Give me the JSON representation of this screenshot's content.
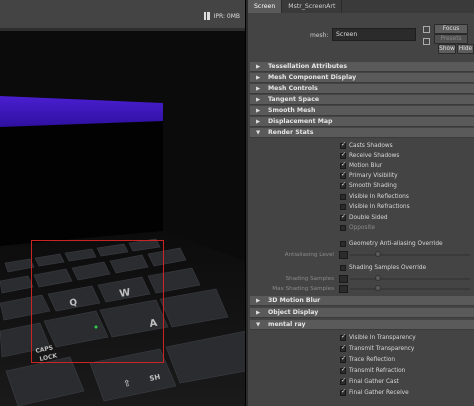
{
  "viewport": {
    "ipr_status": "IPR: 0MB"
  },
  "attribute_editor": {
    "tabs": [
      {
        "label": "Screen",
        "active": true
      },
      {
        "label": "Mstr_ScreenArt",
        "active": false
      }
    ],
    "mesh_label": "mesh:",
    "mesh_value": "Screen",
    "buttons": {
      "focus": "Focus",
      "presets": "Presets",
      "show": "Show",
      "hide": "Hide"
    },
    "sections": {
      "tessellation": "Tessellation Attributes",
      "mesh_component_display": "Mesh Component Display",
      "mesh_controls": "Mesh Controls",
      "tangent_space": "Tangent Space",
      "smooth_mesh": "Smooth Mesh",
      "displacement_map": "Displacement Map",
      "render_stats": "Render Stats",
      "motion_blur_3d": "3D Motion Blur",
      "object_display": "Object Display",
      "mental_ray": "mental ray"
    },
    "render_stats": [
      {
        "label": "Casts Shadows",
        "checked": true
      },
      {
        "label": "Receive Shadows",
        "checked": true
      },
      {
        "label": "Motion Blur",
        "checked": true
      },
      {
        "label": "Primary Visibility",
        "checked": true
      },
      {
        "label": "Smooth Shading",
        "checked": true
      },
      {
        "label": "Visible In Reflections",
        "checked": false
      },
      {
        "label": "Visible In Refractions",
        "checked": false
      },
      {
        "label": "Double Sided",
        "checked": true
      },
      {
        "label": "Opposite",
        "checked": false
      }
    ],
    "geometry_aa_override": "Geometry Anti-aliasing Override",
    "antialiasing_level_label": "Antialiasing Level",
    "shading_samples_override": "Shading Samples Override",
    "shading_samples_label": "Shading Samples",
    "max_shading_samples_label": "Max Shading Samples",
    "mental_ray_items": [
      {
        "label": "Visible In Transparency",
        "checked": true
      },
      {
        "label": "Transmit Transparency",
        "checked": true
      },
      {
        "label": "Trace Reflection",
        "checked": true
      },
      {
        "label": "Transmit Refraction",
        "checked": true
      },
      {
        "label": "Final Gather Cast",
        "checked": true
      },
      {
        "label": "Final Gather Receive",
        "checked": true
      }
    ]
  }
}
